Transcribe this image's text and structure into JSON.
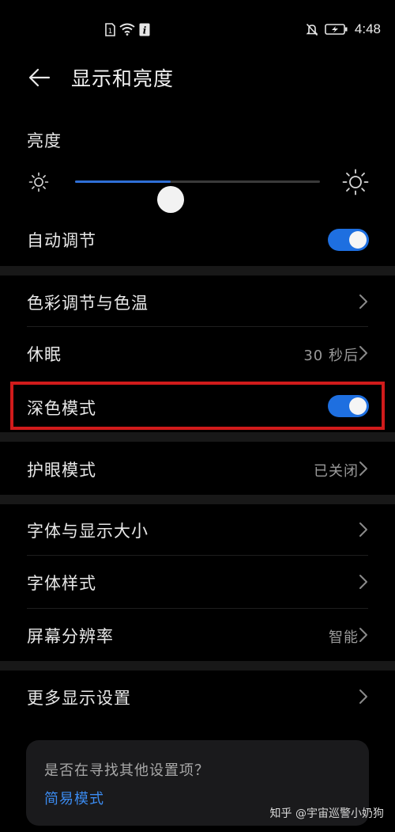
{
  "status_bar": {
    "time": "4:48",
    "icons": [
      "sim-icon",
      "wifi-icon",
      "info-icon",
      "mute-icon",
      "battery-charging-icon"
    ]
  },
  "header": {
    "title": "显示和亮度",
    "back_icon": "back-arrow-icon"
  },
  "brightness": {
    "label": "亮度",
    "level": 0.39,
    "accent": "#2f6fd6"
  },
  "auto_adjust": {
    "label": "自动调节",
    "on": true
  },
  "items": {
    "color": {
      "label": "色彩调节与色温"
    },
    "sleep": {
      "label": "休眠",
      "value": "30 秒后"
    },
    "dark_mode": {
      "label": "深色模式",
      "on": true
    },
    "eye_comfort": {
      "label": "护眼模式",
      "value": "已关闭"
    },
    "font_size": {
      "label": "字体与显示大小"
    },
    "font_style": {
      "label": "字体样式"
    },
    "resolution": {
      "label": "屏幕分辨率",
      "value": "智能"
    },
    "more": {
      "label": "更多显示设置"
    }
  },
  "card": {
    "text": "是否在寻找其他设置项？",
    "link": "简易模式"
  },
  "watermark": "知乎 @宇宙巡警小奶狗",
  "colors": {
    "toggle_on": "#1e6fe0",
    "highlight_border": "#d11b1b",
    "link": "#3b8bf0"
  }
}
